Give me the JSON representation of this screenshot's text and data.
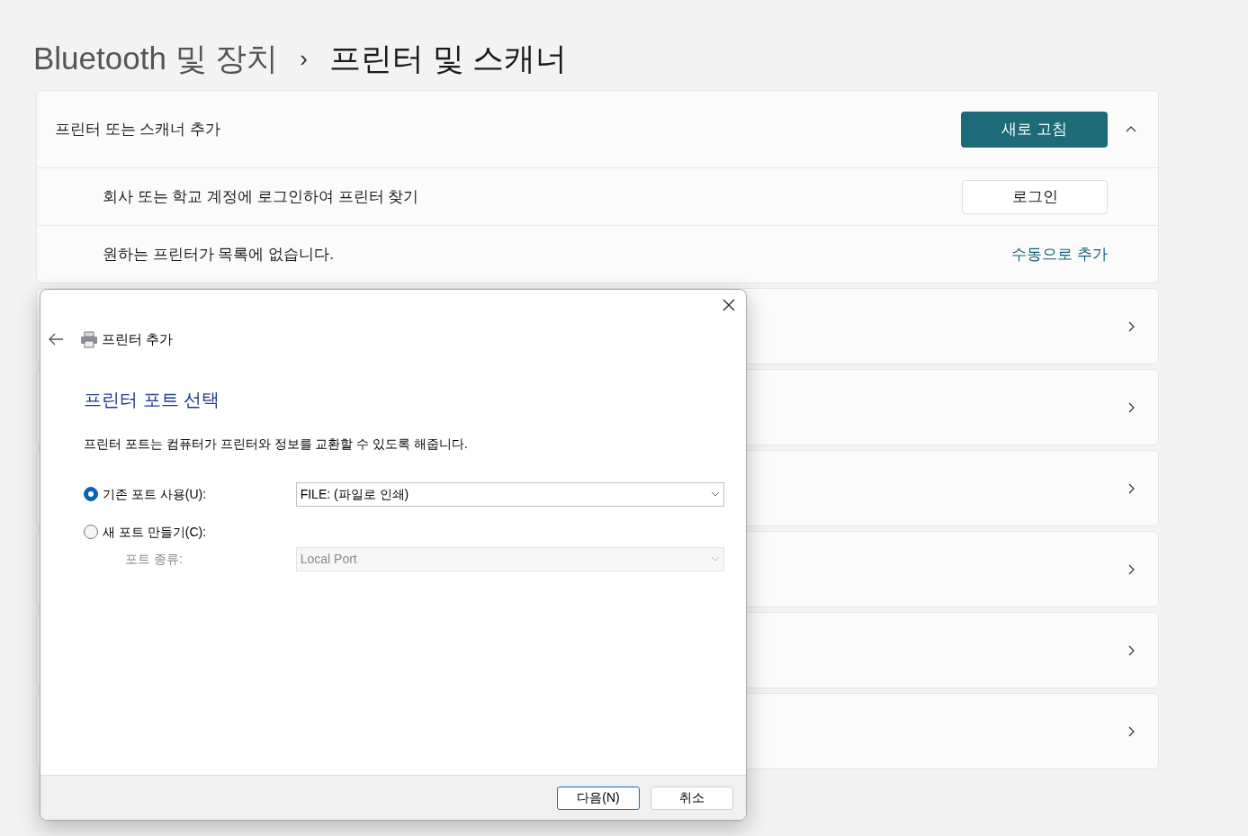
{
  "breadcrumb": {
    "parent": "Bluetooth 및 장치",
    "separator": "›",
    "current": "프린터 및 스캐너"
  },
  "add_section": {
    "title": "프린터 또는 스캐너 추가",
    "refresh_button": "새로 고침",
    "expanded": true,
    "rows": [
      {
        "kind": "button",
        "text": "회사 또는 학교 계정에 로그인하여 프린터 찾기",
        "action": "로그인"
      },
      {
        "kind": "link",
        "text": "원하는 프린터가 목록에 없습니다.",
        "action": "수동으로 추가"
      }
    ]
  },
  "device_rows": [
    {
      "kind": "chevron"
    },
    {
      "kind": "chevron"
    },
    {
      "kind": "chevron"
    },
    {
      "kind": "chevron"
    },
    {
      "kind": "chevron"
    },
    {
      "kind": "chevron"
    }
  ],
  "dialog": {
    "title": "프린터 추가",
    "heading": "프린터 포트 선택",
    "description": "프린터 포트는 컴퓨터가 프린터와 정보를 교환할 수 있도록 해줍니다.",
    "options": [
      {
        "label": "기존 포트 사용(U):",
        "selected": true,
        "field": "FILE: (파일로 인쇄)",
        "disabled": false
      },
      {
        "label": "새 포트 만들기(C):",
        "selected": false,
        "sub_label": "포트 종류:",
        "field": "Local Port",
        "disabled": true
      }
    ],
    "buttons": [
      {
        "label": "다음(N)",
        "default": true
      },
      {
        "label": "취소",
        "default": false
      }
    ]
  }
}
